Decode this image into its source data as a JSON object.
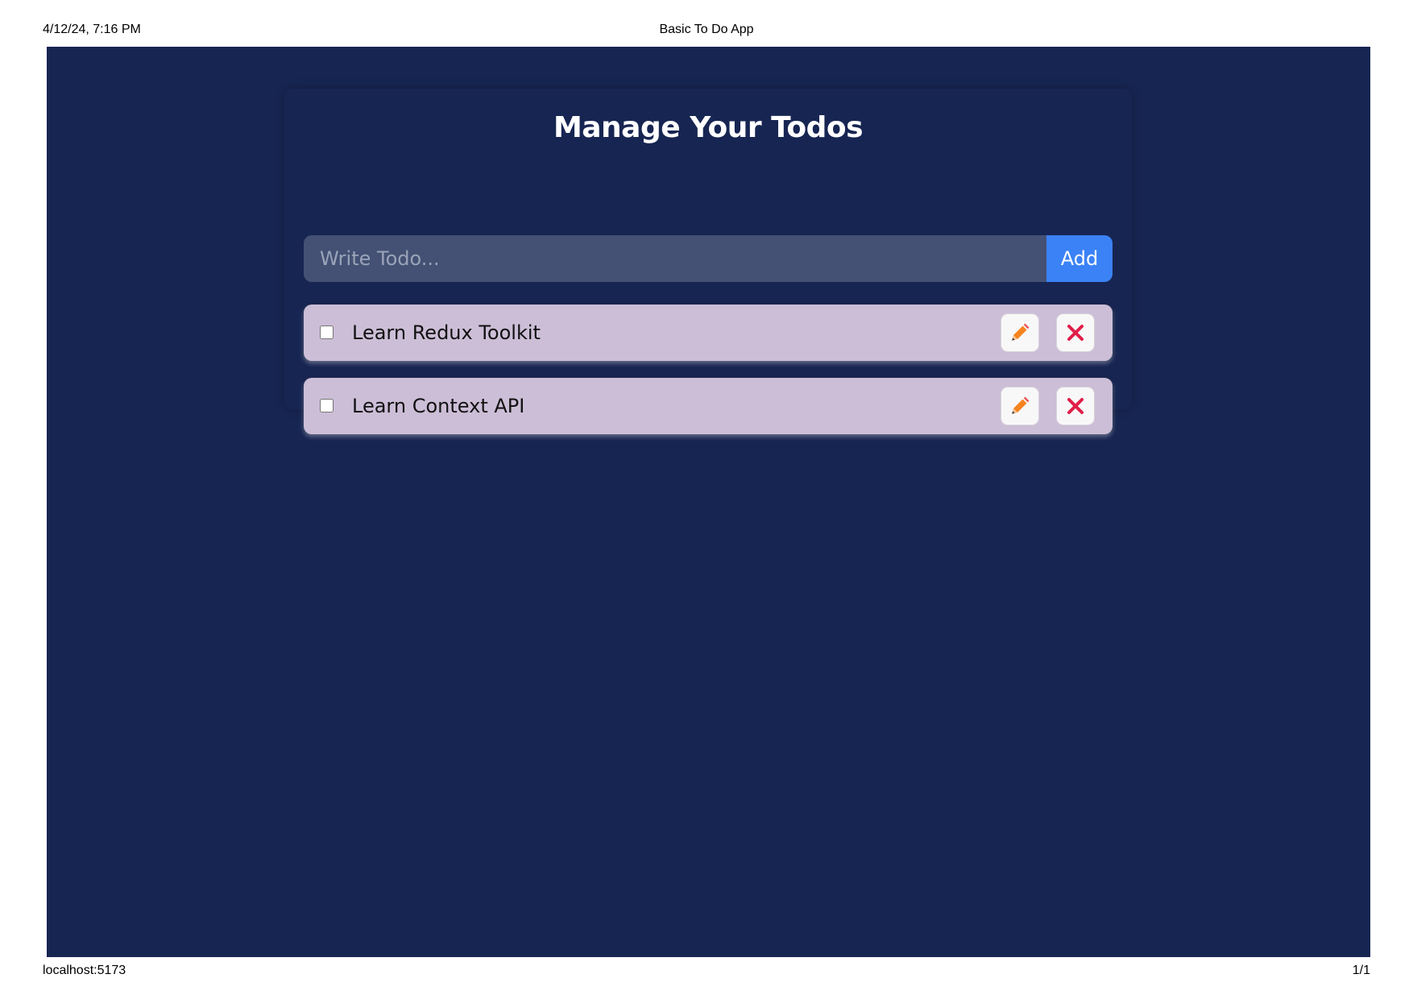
{
  "print_header": {
    "datetime": "4/12/24, 7:16 PM",
    "page_title": "Basic To Do App"
  },
  "print_footer": {
    "url": "localhost:5173",
    "page_count": "1/1"
  },
  "app": {
    "title": "Manage Your Todos",
    "form": {
      "placeholder": "Write Todo...",
      "value": "",
      "add_label": "Add"
    },
    "todos": [
      {
        "text": "Learn Redux Toolkit",
        "completed": false
      },
      {
        "text": "Learn Context API",
        "completed": false
      }
    ],
    "icons": {
      "edit": "pencil-icon",
      "delete": "close-icon"
    }
  },
  "colors": {
    "background": "#172552",
    "input_bg": "#445174",
    "add_button": "#3b82f6",
    "todo_item_bg": "#ccbed7",
    "pencil": "#f5831f",
    "delete_x": "#e11d48"
  }
}
